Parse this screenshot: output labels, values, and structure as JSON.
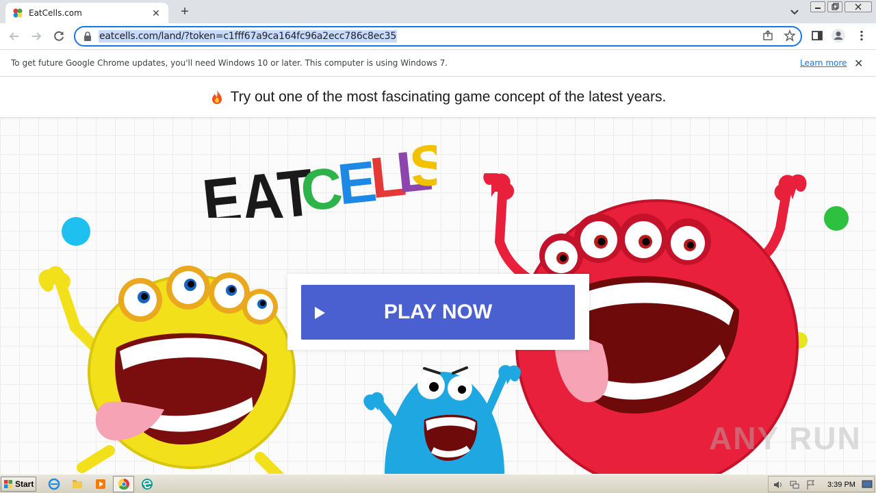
{
  "browser": {
    "tab_title": "EatCells.com",
    "url": "eatcells.com/land/?token=c1fff67a9ca164fc96a2ecc786c8ec35",
    "infobar_message": "To get future Google Chrome updates, you'll need Windows 10 or later. This computer is using Windows 7.",
    "infobar_link": "Learn more",
    "accent_color": "#1a73e8"
  },
  "page": {
    "banner_text": "Try out one of the most fascinating game concept of the latest years.",
    "logo_word_1": "EAT",
    "logo_word_2": "CELLS",
    "play_label": "PLAY NOW",
    "play_button_color": "#4a60d1",
    "watermark": "ANY RUN"
  },
  "taskbar": {
    "start_label": "Start",
    "clock": "3:39 PM"
  }
}
